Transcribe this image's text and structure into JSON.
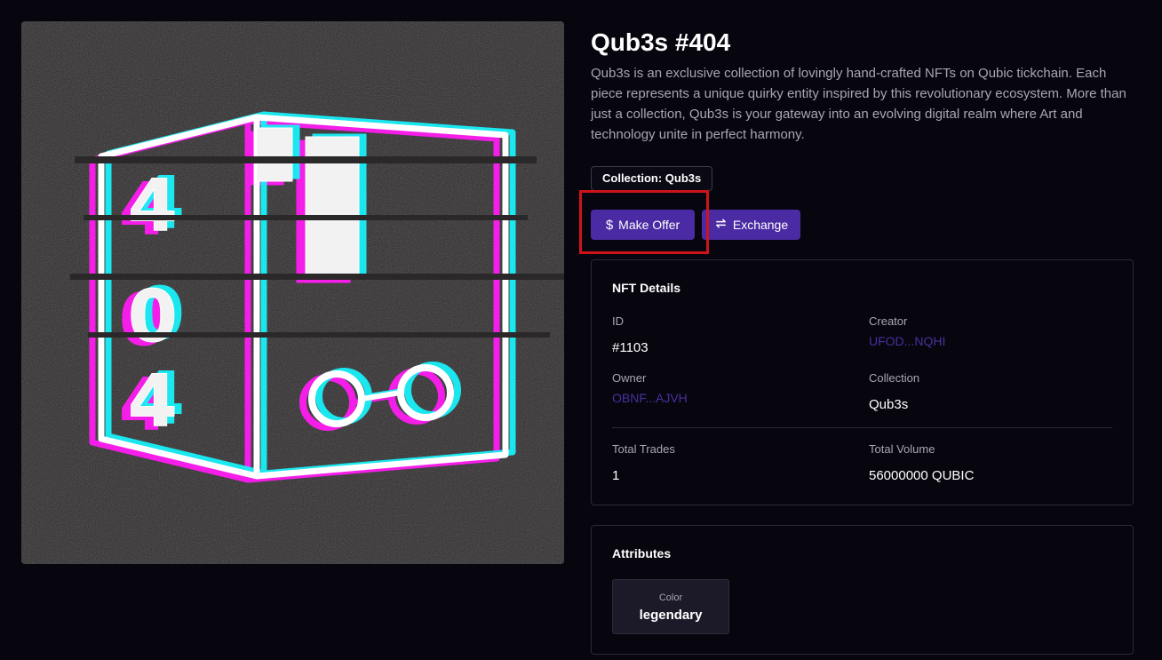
{
  "nft": {
    "title": "Qub3s #404",
    "description": "Qub3s is an exclusive collection of lovingly hand-crafted NFTs on Qubic tickchain. Each piece represents a unique quirky entity inspired by this revolutionary ecosystem. More than just a collection, Qub3s is your gateway into an evolving digital realm where Art and technology unite in perfect harmony.",
    "collection_badge": "Collection: Qub3s",
    "image_alt": "Qub3s #404 glitch cube artwork"
  },
  "actions": {
    "make_offer_label": "Make Offer",
    "make_offer_icon": "dollar-icon",
    "exchange_label": "Exchange",
    "exchange_icon": "exchange-arrows-icon"
  },
  "details": {
    "heading": "NFT Details",
    "id_label": "ID",
    "id_value": "#1103",
    "creator_label": "Creator",
    "creator_value": "UFOD...NQHI",
    "owner_label": "Owner",
    "owner_value": "OBNF...AJVH",
    "collection_label": "Collection",
    "collection_value": "Qub3s",
    "total_trades_label": "Total Trades",
    "total_trades_value": "1",
    "total_volume_label": "Total Volume",
    "total_volume_value": "56000000 QUBIC"
  },
  "attributes": {
    "heading": "Attributes",
    "items": [
      {
        "label": "Color",
        "value": "legendary"
      }
    ]
  },
  "colors": {
    "background": "#07060f",
    "accent": "#4a2ba3",
    "link": "#4b2f9e",
    "muted_text": "#a8a6b3",
    "highlight": "#d0131b",
    "glitch_cyan": "#18f0f8",
    "glitch_magenta": "#ff1cf2"
  }
}
